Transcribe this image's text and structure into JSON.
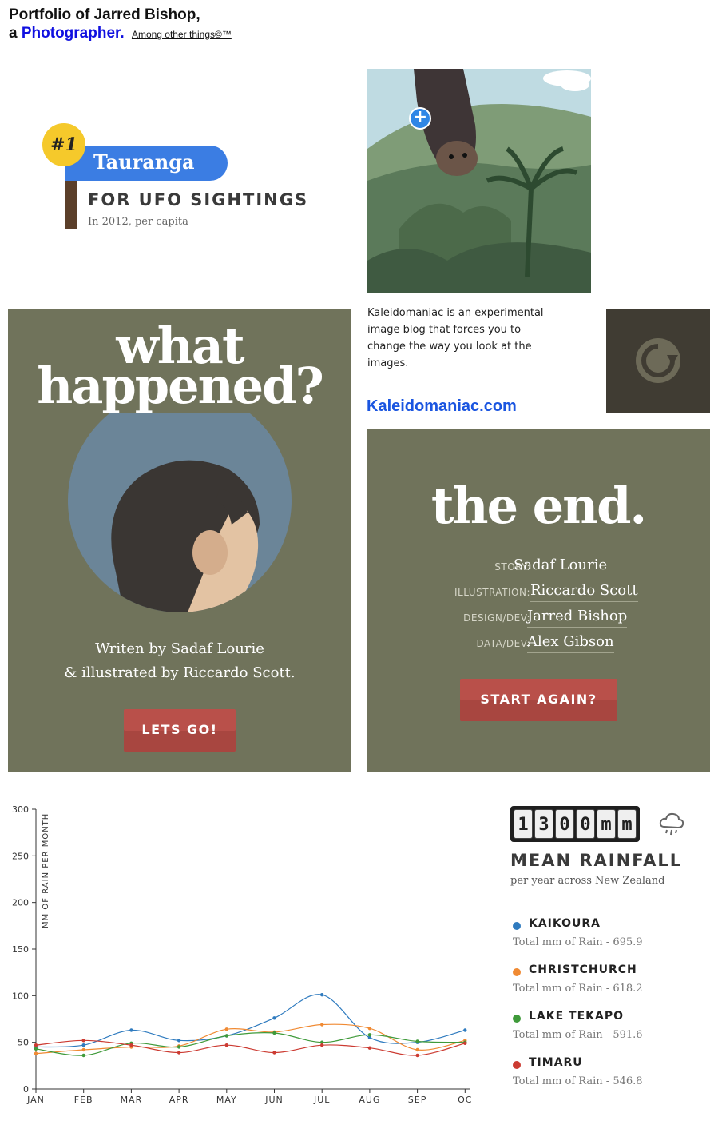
{
  "header": {
    "line1": "Portfolio of Jarred Bishop,",
    "line2_prefix": "a",
    "line2_highlight": "Photographer.",
    "tagline": "Among other things©™"
  },
  "ufo": {
    "rank": "#1",
    "city": "Tauranga",
    "headline": "FOR UFO SIGHTINGS",
    "sub": "In 2012, per capita"
  },
  "kaleidomaniac": {
    "description": "Kaleidomaniac is an experimental image blog that forces you to change the way you look at the images.",
    "link": "Kaleidomaniac.com",
    "plus_icon": "plus-icon",
    "reload_icon": "reload-icon"
  },
  "story_intro": {
    "title_line1": "what",
    "title_line2": "happened?",
    "credit_line1": "Writen by Sadaf Lourie",
    "credit_line2": "& illustrated by Riccardo Scott.",
    "button": "LETS GO!"
  },
  "story_end": {
    "title": "the end.",
    "credits": [
      {
        "role": "STORY:",
        "name": "Sadaf Lourie"
      },
      {
        "role": "ILLUSTRATION:",
        "name": "Riccardo Scott"
      },
      {
        "role": "DESIGN/DEV:",
        "name": "Jarred Bishop"
      },
      {
        "role": "DATA/DEV:",
        "name": "Alex Gibson"
      }
    ],
    "button": "START AGAIN?"
  },
  "rainfall": {
    "digits": [
      "1",
      "3",
      "0",
      "0",
      "m",
      "m"
    ],
    "title": "MEAN RAINFALL",
    "sub": "per year across New Zealand",
    "legend": [
      {
        "name": "KAIKOURA",
        "total": "Total mm of Rain - 695.9",
        "color": "#2f7bbf"
      },
      {
        "name": "CHRISTCHURCH",
        "total": "Total mm of Rain - 618.2",
        "color": "#f08a33"
      },
      {
        "name": "LAKE TEKAPO",
        "total": "Total mm of Rain - 591.6",
        "color": "#3f9a3a"
      },
      {
        "name": "TIMARU",
        "total": "Total mm of Rain - 546.8",
        "color": "#cc3b32"
      }
    ]
  },
  "chart_data": {
    "type": "line",
    "ylabel": "MM OF RAIN PER MONTH",
    "ylim": [
      0,
      300
    ],
    "yticks": [
      0,
      50,
      100,
      150,
      200,
      250,
      300
    ],
    "categories": [
      "JAN",
      "FEB",
      "MAR",
      "APR",
      "MAY",
      "JUN",
      "JUL",
      "AUG",
      "SEP",
      "OC"
    ],
    "series": [
      {
        "name": "KAIKOURA",
        "color": "#2f7bbf",
        "values": [
          45,
          47,
          63,
          52,
          57,
          76,
          101,
          55,
          50,
          63
        ]
      },
      {
        "name": "CHRISTCHURCH",
        "color": "#f08a33",
        "values": [
          38,
          42,
          45,
          46,
          64,
          61,
          69,
          65,
          42,
          52
        ]
      },
      {
        "name": "LAKE TEKAPO",
        "color": "#3f9a3a",
        "values": [
          43,
          36,
          49,
          45,
          57,
          60,
          50,
          58,
          51,
          50
        ]
      },
      {
        "name": "TIMARU",
        "color": "#cc3b32",
        "values": [
          47,
          52,
          47,
          39,
          47,
          39,
          47,
          44,
          36,
          49
        ]
      }
    ],
    "grid": false
  }
}
